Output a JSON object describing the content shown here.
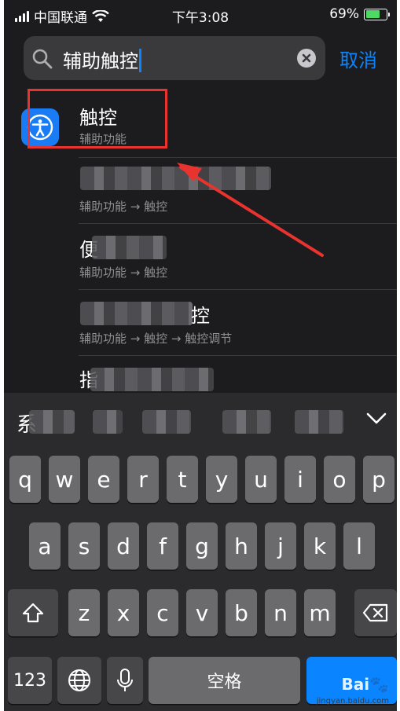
{
  "status": {
    "carrier": "中国联通",
    "time": "下午3:08",
    "battery": "69%",
    "battery_level": 0.69
  },
  "search": {
    "query": "辅助触控",
    "cancel": "取消"
  },
  "results": [
    {
      "title": "触控",
      "subtitle": "辅助功能"
    },
    {
      "subtitle": "辅助功能 → 触控"
    },
    {
      "title_partial": "便",
      "subtitle": "辅助功能 → 触控"
    },
    {
      "title_partial": "控",
      "subtitle": "辅助功能 → 触控 → 触控调节"
    },
    {
      "title_partial": "指"
    }
  ],
  "keyboard": {
    "suggest_partial": "系",
    "row1": [
      "q",
      "w",
      "e",
      "r",
      "t",
      "y",
      "u",
      "i",
      "o",
      "p"
    ],
    "row2": [
      "a",
      "s",
      "d",
      "f",
      "g",
      "h",
      "j",
      "k",
      "l"
    ],
    "row3": [
      "z",
      "x",
      "c",
      "v",
      "b",
      "n",
      "m"
    ],
    "numbers": "123",
    "space": "空格",
    "watermark": "Bai",
    "watermark_sub": "jingyan.baidu.com"
  },
  "colors": {
    "accent": "#0a84ff",
    "annotation": "#e8332f",
    "background": "#1c1c1e"
  },
  "icons": [
    "signal-icon",
    "wifi-icon",
    "battery-icon",
    "search-icon",
    "clear-icon",
    "accessibility-icon",
    "chevron-down-icon",
    "shift-icon",
    "delete-icon",
    "globe-icon",
    "mic-icon"
  ]
}
